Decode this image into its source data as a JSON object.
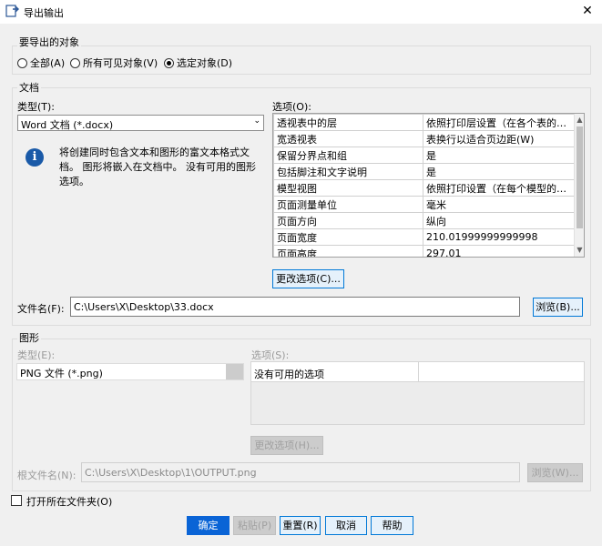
{
  "window": {
    "title": "导出输出"
  },
  "export_objects": {
    "label": "要导出的对象",
    "options": [
      {
        "label": "全部(A)",
        "selected": false
      },
      {
        "label": "所有可见对象(V)",
        "selected": false
      },
      {
        "label": "选定对象(D)",
        "selected": true
      }
    ]
  },
  "document": {
    "label": "文档",
    "type_label": "类型(T):",
    "type_value": "Word 文档 (*.docx)",
    "info_text": "将创建同时包含文本和图形的富文本格式文档。 图形将嵌入在文档中。 没有可用的图形选项。",
    "options_label": "选项(O):",
    "options_rows": [
      {
        "name": "透视表中的层",
        "value": "依照打印层设置（在各个表的…"
      },
      {
        "name": "宽透视表",
        "value": "表换行以适合页边距(W)"
      },
      {
        "name": "保留分界点和组",
        "value": "是"
      },
      {
        "name": "包括脚注和文字说明",
        "value": "是"
      },
      {
        "name": "模型视图",
        "value": "依照打印设置（在每个模型的…"
      },
      {
        "name": "页面测量单位",
        "value": "毫米"
      },
      {
        "name": "页面方向",
        "value": "纵向"
      },
      {
        "name": "页面宽度",
        "value": "210.01999999999998"
      },
      {
        "name": "页面高度",
        "value": "297.01"
      }
    ],
    "change_options_button": "更改选项(C)...",
    "file_name_label": "文件名(F):",
    "file_name_value": "C:\\Users\\X\\Desktop\\33.docx",
    "browse_button": "浏览(B)..."
  },
  "graphics": {
    "label": "图形",
    "type_label": "类型(E):",
    "type_value": "PNG 文件 (*.png)",
    "options_label": "选项(S):",
    "options_row": "没有可用的选项",
    "change_options_button": "更改选项(H)...",
    "root_file_label": "根文件名(N):",
    "root_file_value": "C:\\Users\\X\\Desktop\\1\\OUTPUT.png",
    "browse_button": "浏览(W)..."
  },
  "open_folder": {
    "label": "打开所在文件夹(O)",
    "checked": false
  },
  "buttons": {
    "ok": "确定",
    "paste": "粘贴(P)",
    "reset": "重置(R)",
    "cancel": "取消",
    "help": "帮助"
  },
  "colors": {
    "accent": "#0a64d6",
    "info_icon": "#1a5aa8"
  }
}
